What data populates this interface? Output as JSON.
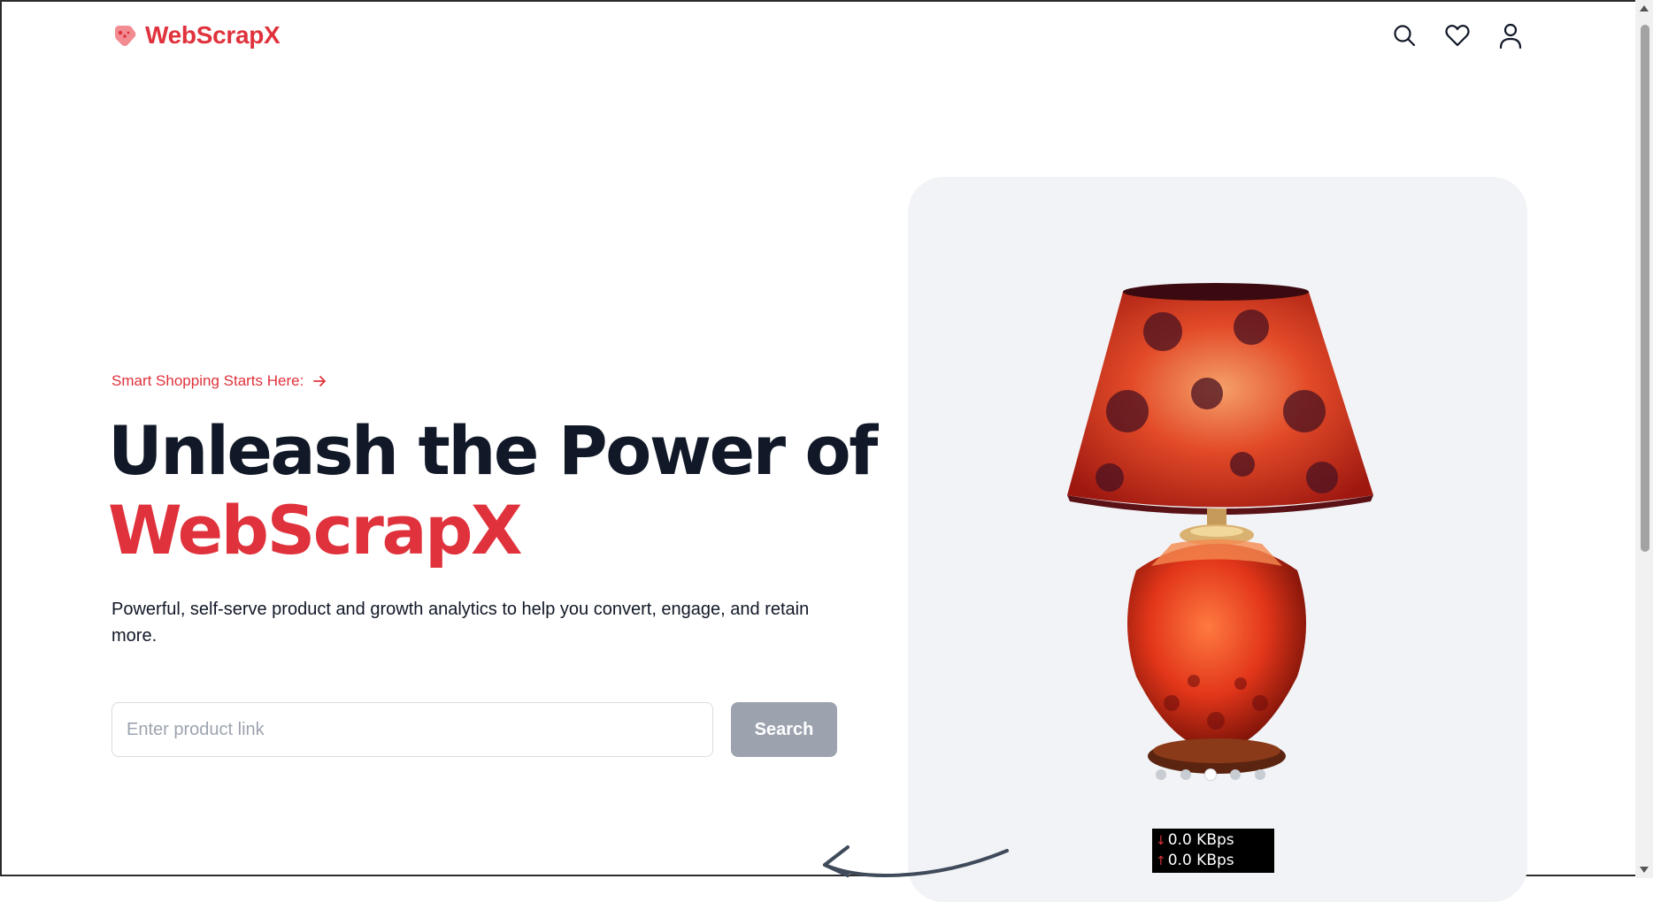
{
  "brand": {
    "name": "WebScrapX",
    "color": "#e0323c"
  },
  "header": {
    "icons": [
      "search-icon",
      "heart-icon",
      "user-icon"
    ]
  },
  "hero": {
    "kicker": "Smart Shopping Starts Here:",
    "headline_line1": "Unleash the Power of",
    "headline_line2": "WebScrapX",
    "subtitle": "Powerful, self-serve product and growth analytics to help you convert, engage, and retain more.",
    "search": {
      "placeholder": "Enter product link",
      "value": "",
      "button_label": "Search"
    }
  },
  "carousel": {
    "slide_count": 5,
    "active_index": 2
  },
  "network_monitor": {
    "download": "0.0 KBps",
    "upload": "0.0 KBps"
  },
  "colors": {
    "accent": "#e0323c",
    "heading": "#111827",
    "card_bg": "#f2f3f6",
    "button_disabled": "#9ca3af"
  }
}
